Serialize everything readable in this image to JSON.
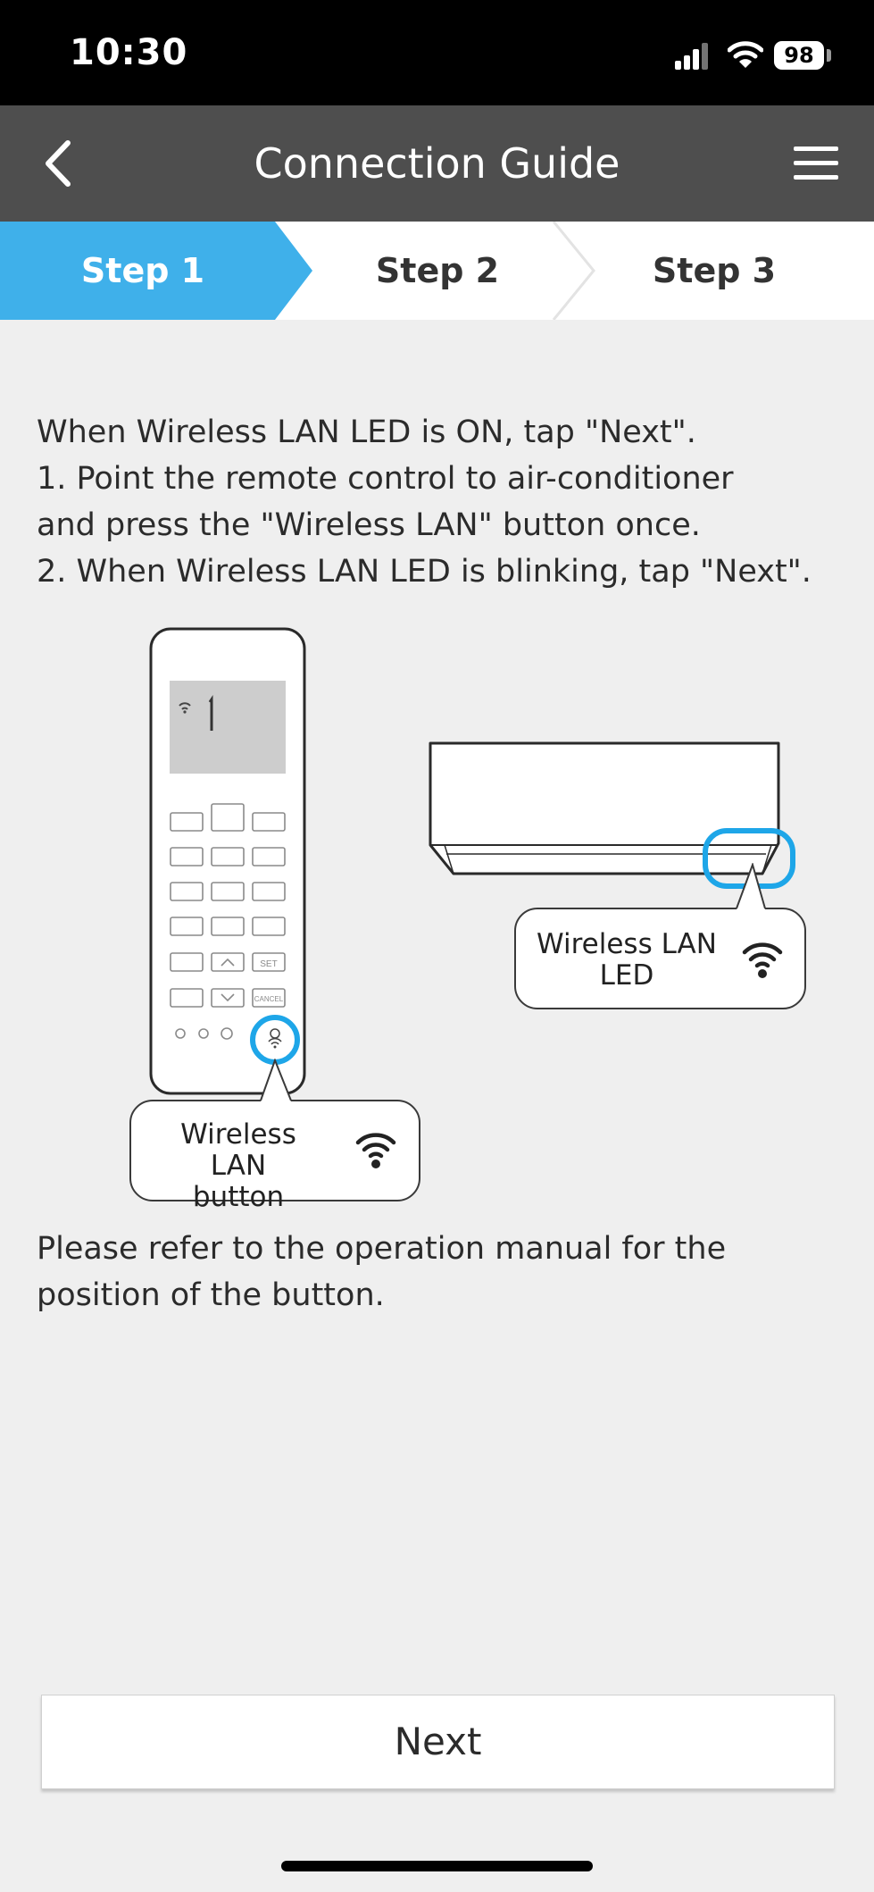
{
  "status_bar": {
    "time": "10:30",
    "battery": "98"
  },
  "header": {
    "title": "Connection Guide"
  },
  "steps": [
    {
      "label": "Step 1",
      "active": true
    },
    {
      "label": "Step 2",
      "active": false
    },
    {
      "label": "Step 3",
      "active": false
    }
  ],
  "instructions": [
    "When Wireless LAN LED is ON, tap \"Next\".",
    "1. Point the remote control to air-conditioner",
    "and press the \"Wireless LAN\" button once.",
    "2. When Wireless LAN LED is blinking, tap \"Next\"."
  ],
  "illustration": {
    "led_callout": {
      "line1": "Wireless LAN",
      "line2": "LED"
    },
    "button_callout": {
      "line1": "Wireless LAN",
      "line2": "button"
    },
    "remote_labels": {
      "set": "SET",
      "cancel": "CANCEL"
    }
  },
  "note": {
    "line1": "Please refer to the operation manual for the",
    "line2": "position of the button."
  },
  "footer": {
    "next_label": "Next"
  },
  "colors": {
    "accent": "#3fb0ea",
    "header_bg": "#4e4e4e",
    "page_bg": "#efefef",
    "highlight_ring": "#1ea6e8"
  }
}
